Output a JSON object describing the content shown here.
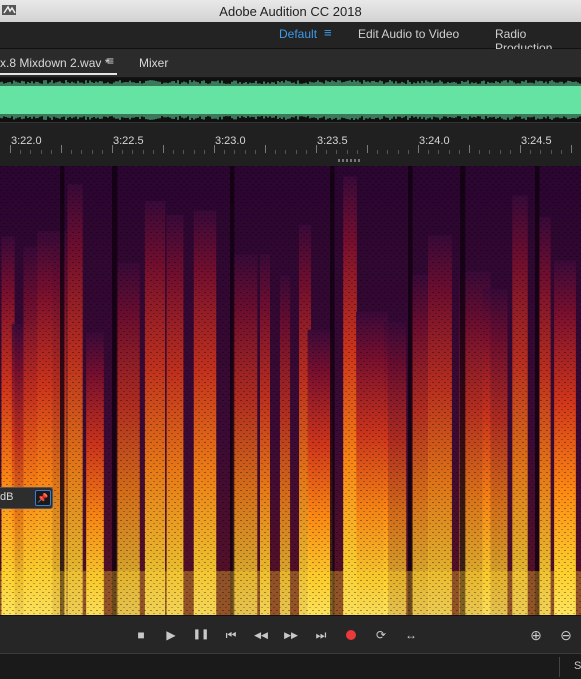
{
  "window": {
    "title": "Adobe Audition CC 2018"
  },
  "workspaces": {
    "items": [
      "Default",
      "Edit Audio to Video",
      "Radio Production"
    ],
    "active": "Default",
    "menu_glyph": "≡"
  },
  "tabs": {
    "file_tab": "x.8 Mixdown 2.wav *",
    "menu_glyph": "≡",
    "mixer_tab": "Mixer"
  },
  "ruler": {
    "labels": [
      "3:22.0",
      "3:22.5",
      "3:23.0",
      "3:23.5",
      "3:24.0",
      "3:24.5"
    ]
  },
  "hud": {
    "text": "dB",
    "pin_icon": "pin-icon"
  },
  "transport": {
    "buttons": [
      "stop-icon",
      "play-icon",
      "pause-icon",
      "go-to-start-icon",
      "rewind-icon",
      "fast-forward-icon",
      "go-to-end-icon",
      "record-icon",
      "loop-icon",
      "skip-selection-icon",
      "zoom-in-amplitude-icon",
      "zoom-out-amplitude-icon"
    ],
    "glyphs": {
      "stop": "■",
      "play": "▶",
      "pause": "❚❚",
      "start": "⏮",
      "rewind": "◀◀",
      "ff": "▶▶",
      "end": "⏭",
      "loop": "⟳",
      "skip": "↔",
      "zoom_in": "⊕",
      "zoom_out": "⊖"
    }
  },
  "statusbar": {
    "text": "S"
  },
  "colors": {
    "accent": "#3d9be9",
    "waveform": "#64e3a3",
    "record": "#e83a3a"
  }
}
